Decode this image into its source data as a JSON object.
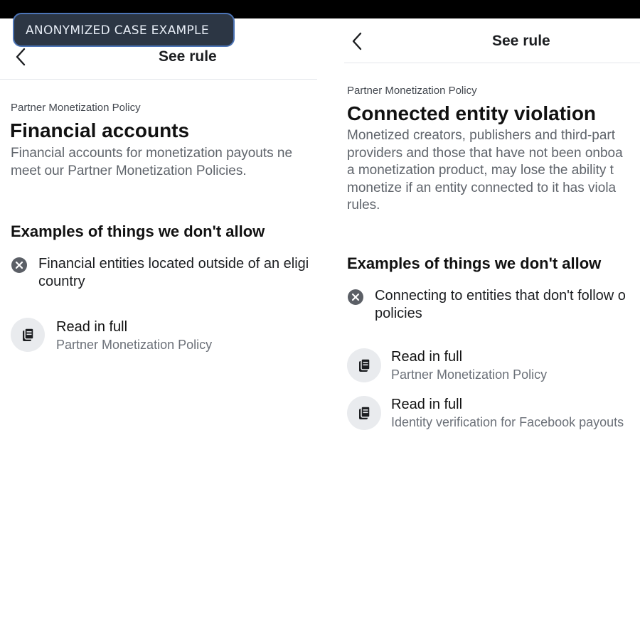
{
  "overlay": {
    "badge_label": "ANONYMIZED CASE EXAMPLE"
  },
  "colors": {
    "topbar": "#000000",
    "badge_background": "#2c3644",
    "badge_border": "#4c74b6",
    "text_primary": "#1c1e21",
    "text_secondary": "#5f646b",
    "icon_circle": "#e9ebee"
  },
  "icons": [
    "back-chevron-icon",
    "close-circle-icon",
    "document-icon"
  ],
  "left_panel": {
    "header_title": "See rule",
    "eyebrow": "Partner Monetization Policy",
    "title": "Financial accounts",
    "description_lines": [
      "Financial accounts for monetization payouts ne",
      "meet our Partner Monetization Policies."
    ],
    "section_heading": "Examples of things we don't allow",
    "examples": [
      {
        "lines": [
          "Financial entities located outside of an eligi",
          "country"
        ]
      }
    ],
    "links": [
      {
        "title": "Read in full",
        "subtitle": "Partner Monetization Policy"
      }
    ]
  },
  "right_panel": {
    "header_title": "See rule",
    "eyebrow": "Partner Monetization Policy",
    "title": "Connected entity violation",
    "description_lines": [
      "Monetized creators, publishers and third-part",
      "providers and those that have not been onboa",
      "a monetization product, may lose the ability t",
      "monetize if an entity connected to it has viola",
      "rules."
    ],
    "section_heading": "Examples of things we don't allow",
    "examples": [
      {
        "lines": [
          "Connecting to entities that don't follow o",
          "policies"
        ]
      }
    ],
    "links": [
      {
        "title": "Read in full",
        "subtitle": "Partner Monetization Policy"
      },
      {
        "title": "Read in full",
        "subtitle": "Identity verification for Facebook payouts"
      }
    ]
  }
}
